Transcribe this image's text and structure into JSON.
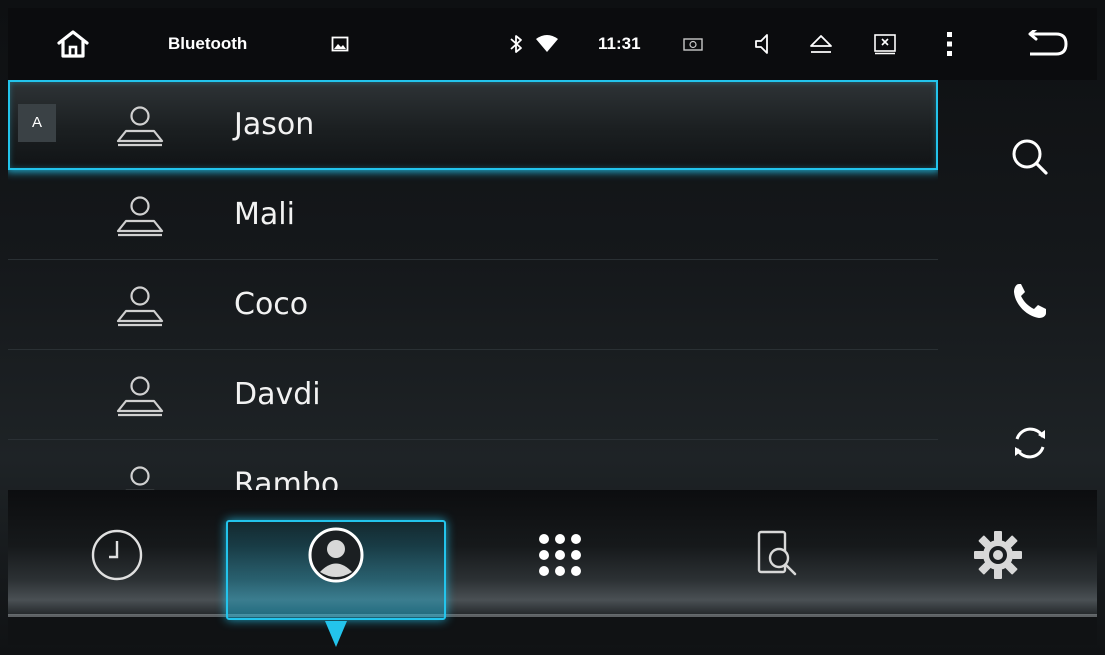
{
  "status_bar": {
    "title": "Bluetooth",
    "time": "11:31",
    "icons": [
      "home-icon",
      "image-icon",
      "bluetooth-icon",
      "wifi-icon",
      "camera-icon",
      "volume-icon",
      "eject-icon",
      "close-window-icon",
      "more-vert-icon",
      "back-icon"
    ]
  },
  "contacts": {
    "section_letter": "A",
    "items": [
      {
        "name": "Jason",
        "selected": true
      },
      {
        "name": "Mali",
        "selected": false
      },
      {
        "name": "Coco",
        "selected": false
      },
      {
        "name": "Davdi",
        "selected": false
      },
      {
        "name": "Rambo",
        "selected": false
      }
    ]
  },
  "side_actions": [
    "search-icon",
    "phone-icon",
    "sync-icon"
  ],
  "tabs": {
    "items": [
      "recent-calls-icon",
      "contacts-icon",
      "dialpad-icon",
      "search-device-icon",
      "settings-icon"
    ],
    "active_index": 1
  },
  "colors": {
    "accent": "#23c4ec",
    "background": "#0a0b0d",
    "text": "#f2f2f2"
  }
}
